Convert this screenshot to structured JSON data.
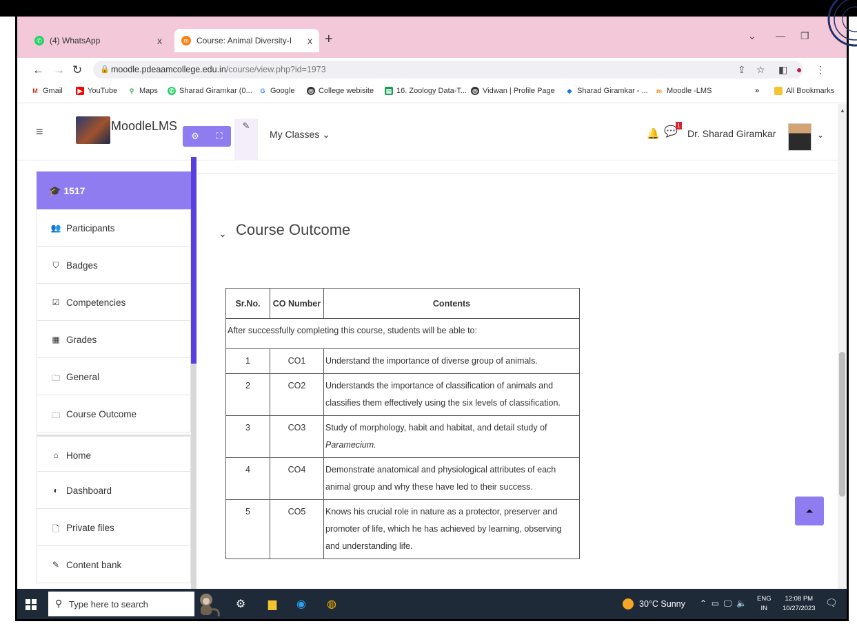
{
  "browser": {
    "tabs": [
      {
        "label": "(4) WhatsApp",
        "close": "x"
      },
      {
        "label": "Course: Animal Diversity-I",
        "close": "x"
      }
    ],
    "new_tab": "+",
    "url_host": "moodle.pdeaamcollege.edu.in",
    "url_path": "/course/view.php?id=1973",
    "bookmarks": [
      {
        "label": "Gmail",
        "icon": "gmail-icon",
        "color": "#d93025"
      },
      {
        "label": "YouTube",
        "icon": "youtube-icon",
        "color": "#ff0000"
      },
      {
        "label": "Maps",
        "icon": "maps-icon",
        "color": "#34a853"
      },
      {
        "label": "Sharad Giramkar (0...",
        "icon": "whatsapp-icon",
        "color": "#25d366"
      },
      {
        "label": "Google",
        "icon": "google-icon",
        "color": "#4285f4"
      },
      {
        "label": "College webisite",
        "icon": "globe-icon",
        "color": "#333333"
      },
      {
        "label": "16. Zoology Data-T...",
        "icon": "sheets-icon",
        "color": "#0f9d58"
      },
      {
        "label": "Vidwan | Profile Page",
        "icon": "globe-icon",
        "color": "#333333"
      },
      {
        "label": "Sharad Giramkar - ...",
        "icon": "cap-icon",
        "color": "#1a73e8"
      },
      {
        "label": "Moodle -LMS",
        "icon": "moodle-icon",
        "color": "#f98012"
      }
    ],
    "more_bookmarks": "»",
    "all_bookmarks": "All Bookmarks"
  },
  "header": {
    "brand": "MoodleLMS",
    "my_classes": "My Classes",
    "user_name": "Dr. Sharad Giramkar",
    "message_badge": "1"
  },
  "sidebar": {
    "active": "1517",
    "items": [
      {
        "label": "Participants",
        "icon": "users-icon",
        "glyph": "👥"
      },
      {
        "label": "Badges",
        "icon": "shield-icon",
        "glyph": "⛉"
      },
      {
        "label": "Competencies",
        "icon": "checkbox-icon",
        "glyph": "☑"
      },
      {
        "label": "Grades",
        "icon": "table-icon",
        "glyph": "▦"
      },
      {
        "label": "General",
        "icon": "folder-icon",
        "glyph": "🗀"
      },
      {
        "label": "Course Outcome",
        "icon": "folder-icon",
        "glyph": "🗀"
      }
    ],
    "items2": [
      {
        "label": "Home",
        "icon": "home-icon",
        "glyph": "⌂"
      },
      {
        "label": "Dashboard",
        "icon": "dashboard-icon",
        "glyph": "◐"
      },
      {
        "label": "Private files",
        "icon": "file-icon",
        "glyph": "🗋"
      },
      {
        "label": "Content bank",
        "icon": "pen-icon",
        "glyph": "✎"
      }
    ]
  },
  "main": {
    "section_title": "Course Outcome",
    "table": {
      "headers": [
        "Sr.No.",
        "CO Number",
        "Contents"
      ],
      "intro": "After successfully completing this course, students will be able to:",
      "rows": [
        {
          "sr": "1",
          "co": "CO1",
          "content": "Understand the importance of diverse group of animals."
        },
        {
          "sr": "2",
          "co": "CO2",
          "content": "Understands the importance of classification of animals and classifies them effectively using the six levels of classification."
        },
        {
          "sr": "3",
          "co": "CO3",
          "content": "Study of morphology, habit and habitat, and detail study of",
          "content_em": "Paramecium."
        },
        {
          "sr": "4",
          "co": "CO4",
          "content": "Demonstrate anatomical and physiological attributes of each animal group and why these have led to their success."
        },
        {
          "sr": "5",
          "co": "CO5",
          "content": "Knows his crucial role in nature as a protector, preserver and promoter of life, which he has achieved by learning, observing and understanding life."
        }
      ]
    }
  },
  "taskbar": {
    "search_placeholder": "Type here to search",
    "weather": "30°C  Sunny",
    "lang_top": "ENG",
    "lang_bottom": "IN",
    "time": "12:08 PM",
    "date": "10/27/2023"
  }
}
